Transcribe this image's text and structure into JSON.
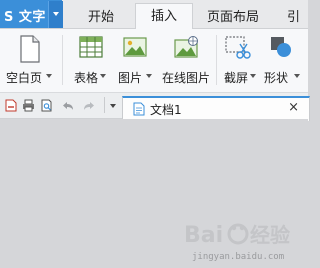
{
  "app_menu": {
    "label": "S 文字"
  },
  "tabs": [
    {
      "label": "开始"
    },
    {
      "label": "插入"
    },
    {
      "label": "页面布局"
    },
    {
      "label": "引用"
    }
  ],
  "active_tab": "插入",
  "ribbon": {
    "items": [
      {
        "label": "空白页",
        "icon": "blank-page-icon",
        "has_dropdown": true
      },
      {
        "label": "表格",
        "icon": "table-icon",
        "has_dropdown": true
      },
      {
        "label": "图片",
        "icon": "picture-icon",
        "has_dropdown": true
      },
      {
        "label": "在线图片",
        "icon": "online-picture-icon",
        "has_dropdown": false
      },
      {
        "label": "截屏",
        "icon": "screenshot-icon",
        "has_dropdown": true
      },
      {
        "label": "形状",
        "icon": "shapes-icon",
        "has_dropdown": true
      }
    ]
  },
  "quick_access": {
    "icons": [
      "export-pdf-icon",
      "print-icon",
      "print-preview-icon",
      "undo-icon",
      "redo-icon",
      "customize-dropdown-icon"
    ]
  },
  "document_tab": {
    "label": "文档1",
    "close_symbol": "×"
  },
  "watermark": {
    "url": "jingyan.baidu.com"
  },
  "colors": {
    "accent": "#3b8fd9",
    "workspace": "#d5d6d9",
    "ribbon": "#f7f8fa"
  }
}
